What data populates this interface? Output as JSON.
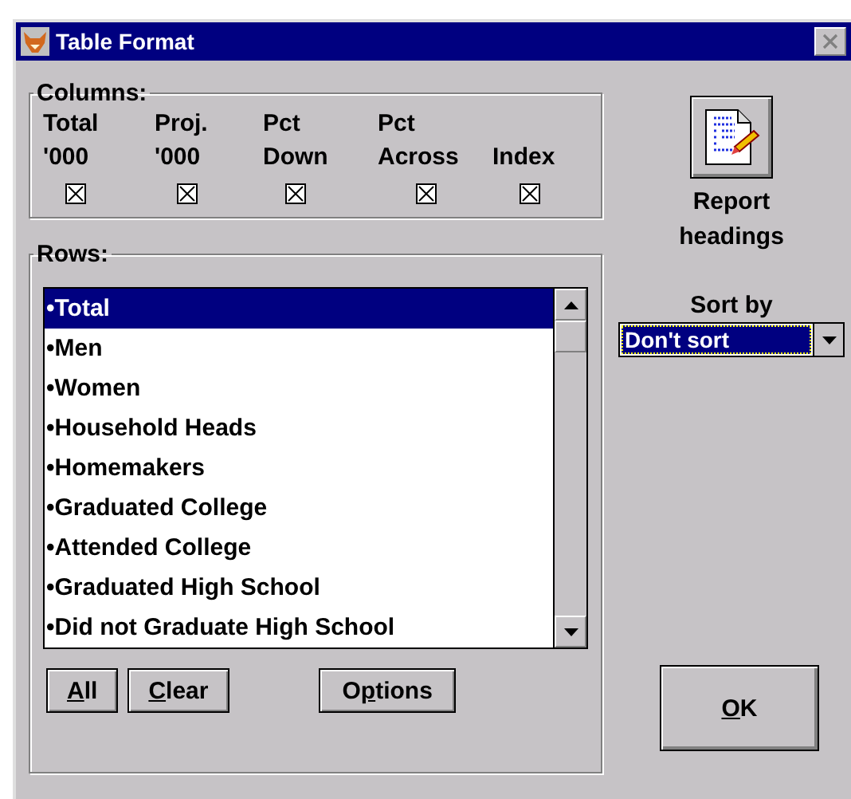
{
  "window": {
    "title": "Table Format"
  },
  "columns": {
    "label": "Columns:",
    "items": [
      {
        "line1": "Total",
        "line2": "'000",
        "checked": true
      },
      {
        "line1": "Proj.",
        "line2": "'000",
        "checked": true
      },
      {
        "line1": "Pct",
        "line2": "Down",
        "checked": true
      },
      {
        "line1": "Pct",
        "line2": "Across",
        "checked": true
      },
      {
        "line2": "Index",
        "checked": true
      }
    ]
  },
  "rows": {
    "label": "Rows:",
    "items": [
      {
        "label": "•Total",
        "selected": true
      },
      {
        "label": "•Men",
        "selected": false
      },
      {
        "label": "•Women",
        "selected": false
      },
      {
        "label": "•Household Heads",
        "selected": false
      },
      {
        "label": "•Homemakers",
        "selected": false
      },
      {
        "label": "•Graduated College",
        "selected": false
      },
      {
        "label": "•Attended College",
        "selected": false
      },
      {
        "label": "•Graduated High School",
        "selected": false
      },
      {
        "label": "•Did not Graduate High School",
        "selected": false
      }
    ],
    "buttons": [
      {
        "key": "A",
        "after": "ll"
      },
      {
        "key": "C",
        "after": "lear"
      },
      {
        "before": "O",
        "key": "p",
        "after": "tions"
      }
    ]
  },
  "report_headings": {
    "label": "Report headings"
  },
  "sort": {
    "label": "Sort by",
    "value": "Don't sort"
  },
  "ok_button": {
    "key": "O",
    "after": "K"
  }
}
